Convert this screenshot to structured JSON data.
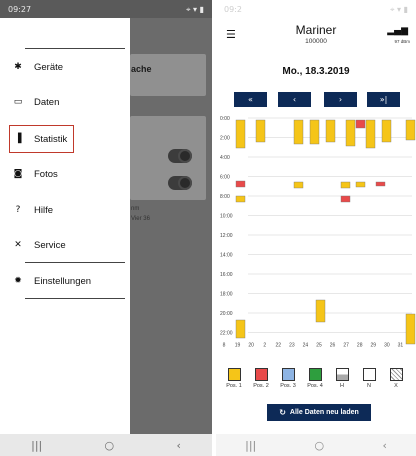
{
  "left_phone": {
    "status": {
      "time": "09:27",
      "icons": "⌖ ▾ ▮"
    },
    "background": {
      "card_title_fragment": "ache",
      "text_line1": "nm",
      "text_line2": "Vier 36"
    },
    "drawer": {
      "items": [
        {
          "label": "Geräte",
          "icon": "bluetooth-icon",
          "glyph": "✱"
        },
        {
          "label": "Daten",
          "icon": "folder-icon",
          "glyph": "▭"
        },
        {
          "label": "Statistik",
          "icon": "bar-chart-icon",
          "glyph": "▐"
        },
        {
          "label": "Fotos",
          "icon": "camera-icon",
          "glyph": "◙"
        },
        {
          "label": "Hilfe",
          "icon": "help-icon",
          "glyph": "?"
        },
        {
          "label": "Service",
          "icon": "tools-icon",
          "glyph": "✕"
        },
        {
          "label": "Einstellungen",
          "icon": "settings-icon",
          "glyph": "✹"
        }
      ],
      "selected": "Statistik"
    },
    "navbar": {
      "recents": "|||",
      "home": "○",
      "back": "‹"
    }
  },
  "right_phone": {
    "status": {
      "time": "09:2",
      "icons": "⌖ ▾ ▮"
    },
    "header": {
      "title": "Mariner",
      "subtitle": "100000",
      "signal_label": "97 dBm"
    },
    "date": "Mo., 18.3.2019",
    "nav_buttons": [
      "«",
      "‹",
      "›",
      "»|"
    ],
    "time_labels": [
      "0:00",
      "2:00",
      "4:00",
      "6:00",
      "8:00",
      "10:00",
      "12:00",
      "14:00",
      "16:00",
      "18:00",
      "20:00",
      "22:00"
    ],
    "day_labels": [
      "8",
      "19",
      "20",
      "2",
      "22",
      "23",
      "24",
      "25",
      "26",
      "27",
      "28",
      "29",
      "30",
      "31"
    ],
    "legend": [
      {
        "label": "Pos. 1",
        "color": "#f5c518",
        "pattern": "solid"
      },
      {
        "label": "Pos. 2",
        "color": "#e84a4a",
        "pattern": "solid"
      },
      {
        "label": "Pos. 3",
        "color": "#8eb4e3",
        "pattern": "solid"
      },
      {
        "label": "Pos. 4",
        "color": "#2e9e3e",
        "pattern": "solid"
      },
      {
        "label": "H",
        "color": "#ffffff",
        "pattern": "half"
      },
      {
        "label": "N",
        "color": "#ffffff",
        "pattern": "empty"
      },
      {
        "label": "X",
        "color": "#ffffff",
        "pattern": "hatch"
      }
    ],
    "reload_label": "Alle Daten neu laden",
    "navbar": {
      "recents": "|||",
      "home": "○",
      "back": "‹"
    }
  }
}
